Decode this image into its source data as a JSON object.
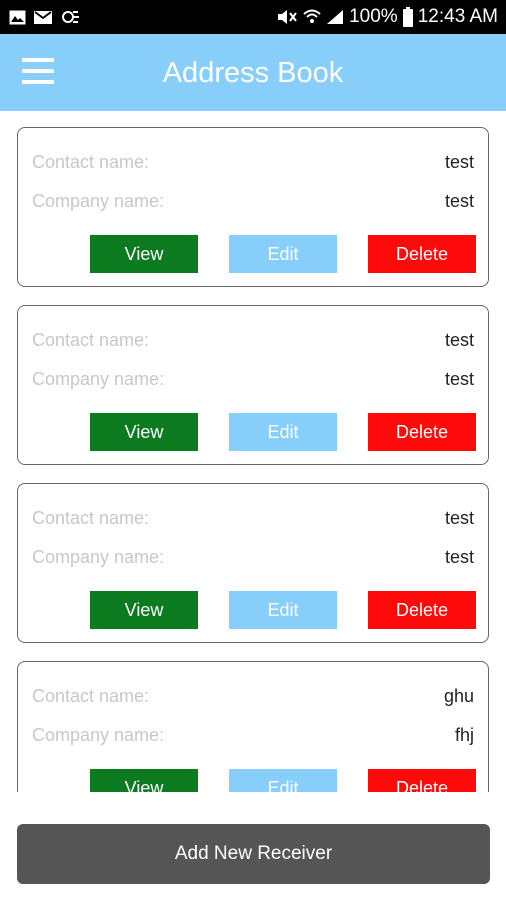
{
  "status_bar": {
    "left_icons": [
      "image-notification-icon",
      "mail-notification-icon",
      "sync-notification-icon"
    ],
    "right_icons": [
      "mute-icon",
      "wifi-icon",
      "signal-icon",
      "battery-icon"
    ],
    "battery": "100%",
    "time": "12:43 AM"
  },
  "app_bar": {
    "title": "Address Book",
    "color": "#87cefa"
  },
  "contacts": [
    {
      "contact_label": "Contact name:",
      "contact_value": "test",
      "company_label": "Company name:",
      "company_value": "test",
      "view": "View",
      "edit": "Edit",
      "delete": "Delete"
    },
    {
      "contact_label": "Contact name:",
      "contact_value": "test",
      "company_label": "Company name:",
      "company_value": "test",
      "view": "View",
      "edit": "Edit",
      "delete": "Delete"
    },
    {
      "contact_label": "Contact name:",
      "contact_value": "test",
      "company_label": "Company name:",
      "company_value": "test",
      "view": "View",
      "edit": "Edit",
      "delete": "Delete"
    },
    {
      "contact_label": "Contact name:",
      "contact_value": "ghu",
      "company_label": "Company name:",
      "company_value": "fhj",
      "view": "View",
      "edit": "Edit",
      "delete": "Delete"
    }
  ],
  "colors": {
    "view": "#0c7a1e",
    "edit": "#87cefa",
    "delete": "#ff0a0a",
    "add_button": "#555555"
  },
  "add_button_label": "Add New Receiver"
}
